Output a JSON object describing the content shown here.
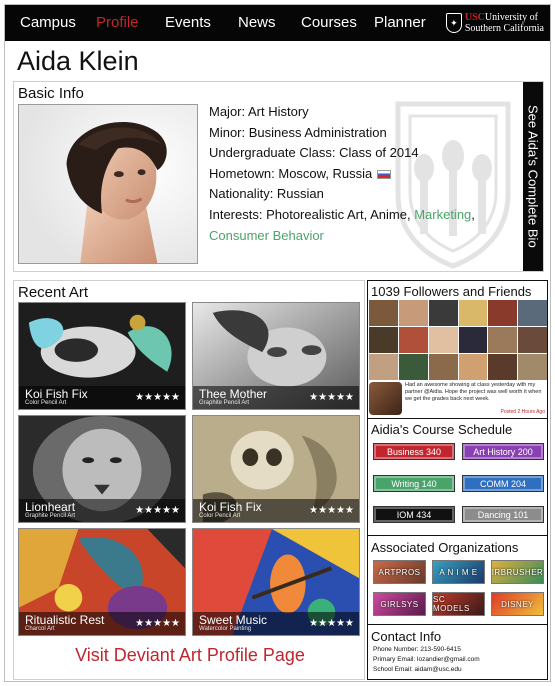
{
  "nav": {
    "items": [
      "Campus",
      "Profile",
      "Events",
      "News",
      "Courses",
      "Planner"
    ],
    "active": "Profile",
    "brand": {
      "usc": "USC",
      "line1": "University of",
      "line2": "Southern California"
    }
  },
  "profile": {
    "name": "Aida Klein"
  },
  "basic_info": {
    "heading": "Basic Info",
    "lines": [
      "Major: Art History",
      "Minor: Business Administration",
      "Undergraduate Class: Class of 2014",
      "Hometown: Moscow, Russia",
      "Nationality: Russian"
    ],
    "interests_prefix": "Interests: Photorealistic Art, Anime, ",
    "interests_link1": "Marketing",
    "interests_comma": ",",
    "interests_link2": "Consumer Behavior",
    "bio_tab": "See Aida's Complete Bio"
  },
  "recent_art": {
    "heading": "Recent Art",
    "pieces": [
      {
        "title": "Koi Fish Fix",
        "medium": "Color Pencil Art",
        "stars": "★★★★★"
      },
      {
        "title": "Thee Mother",
        "medium": "Graphite Pencil Art",
        "stars": "★★★★★"
      },
      {
        "title": "Lionheart",
        "medium": "Graphite Pencil Art",
        "stars": "★★★★★"
      },
      {
        "title": "Koi Fish Fix",
        "medium": "Color Pencil Art",
        "stars": "★★★★★"
      },
      {
        "title": "Ritualistic Rest",
        "medium": "Charcol Art",
        "stars": "★★★★★"
      },
      {
        "title": "Sweet Music",
        "medium": "Watercolor Painting",
        "stars": "★★★★★"
      }
    ],
    "deviant_link": "Visit Deviant Art Profile Page"
  },
  "followers": {
    "heading": "1039 Followers and Friends",
    "post_text": "Had an awesome showing at class yesterday with my partner @Aidia. Hope the project was well worth it when we get the grades back next week.",
    "post_meta": "Posted 2 Hours Ago"
  },
  "schedule": {
    "heading": "Aidia's Course Schedule",
    "courses": [
      {
        "label": "Business 340",
        "color": "#c0262e"
      },
      {
        "label": "Art History 200",
        "color": "#8a3fb3"
      },
      {
        "label": "Writing 140",
        "color": "#4aa36a"
      },
      {
        "label": "COMM 204",
        "color": "#2f6fc0"
      },
      {
        "label": "IOM 434",
        "color": "#111111"
      },
      {
        "label": "Dancing 101",
        "color": "#8c8c8c"
      }
    ]
  },
  "organizations": {
    "heading": "Associated Organizations",
    "items": [
      "ARTPROS",
      "A N I M E",
      "AIRBRUSHERS",
      "GIRLSYS",
      "SC MODELS",
      "DISNEY"
    ]
  },
  "contact": {
    "heading": "Contact Info",
    "phone": "Phone Number: 213-590-6415",
    "primary_email": "Primary Email: lozandier@gmail.com",
    "school_email": "School Email: aidam@usc.edu"
  },
  "colors": {
    "accent_red": "#c0262e",
    "link_green": "#4aa36a",
    "nav_bg": "#060606"
  }
}
